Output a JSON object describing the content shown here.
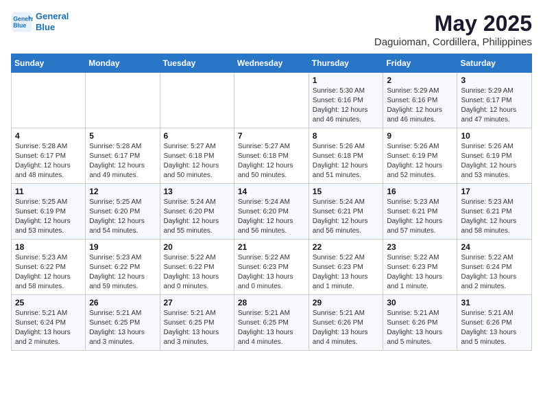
{
  "header": {
    "logo_line1": "General",
    "logo_line2": "Blue",
    "month": "May 2025",
    "location": "Daguioman, Cordillera, Philippines"
  },
  "weekdays": [
    "Sunday",
    "Monday",
    "Tuesday",
    "Wednesday",
    "Thursday",
    "Friday",
    "Saturday"
  ],
  "weeks": [
    [
      {
        "day": "",
        "info": ""
      },
      {
        "day": "",
        "info": ""
      },
      {
        "day": "",
        "info": ""
      },
      {
        "day": "",
        "info": ""
      },
      {
        "day": "1",
        "info": "Sunrise: 5:30 AM\nSunset: 6:16 PM\nDaylight: 12 hours\nand 46 minutes."
      },
      {
        "day": "2",
        "info": "Sunrise: 5:29 AM\nSunset: 6:16 PM\nDaylight: 12 hours\nand 46 minutes."
      },
      {
        "day": "3",
        "info": "Sunrise: 5:29 AM\nSunset: 6:17 PM\nDaylight: 12 hours\nand 47 minutes."
      }
    ],
    [
      {
        "day": "4",
        "info": "Sunrise: 5:28 AM\nSunset: 6:17 PM\nDaylight: 12 hours\nand 48 minutes."
      },
      {
        "day": "5",
        "info": "Sunrise: 5:28 AM\nSunset: 6:17 PM\nDaylight: 12 hours\nand 49 minutes."
      },
      {
        "day": "6",
        "info": "Sunrise: 5:27 AM\nSunset: 6:18 PM\nDaylight: 12 hours\nand 50 minutes."
      },
      {
        "day": "7",
        "info": "Sunrise: 5:27 AM\nSunset: 6:18 PM\nDaylight: 12 hours\nand 50 minutes."
      },
      {
        "day": "8",
        "info": "Sunrise: 5:26 AM\nSunset: 6:18 PM\nDaylight: 12 hours\nand 51 minutes."
      },
      {
        "day": "9",
        "info": "Sunrise: 5:26 AM\nSunset: 6:19 PM\nDaylight: 12 hours\nand 52 minutes."
      },
      {
        "day": "10",
        "info": "Sunrise: 5:26 AM\nSunset: 6:19 PM\nDaylight: 12 hours\nand 53 minutes."
      }
    ],
    [
      {
        "day": "11",
        "info": "Sunrise: 5:25 AM\nSunset: 6:19 PM\nDaylight: 12 hours\nand 53 minutes."
      },
      {
        "day": "12",
        "info": "Sunrise: 5:25 AM\nSunset: 6:20 PM\nDaylight: 12 hours\nand 54 minutes."
      },
      {
        "day": "13",
        "info": "Sunrise: 5:24 AM\nSunset: 6:20 PM\nDaylight: 12 hours\nand 55 minutes."
      },
      {
        "day": "14",
        "info": "Sunrise: 5:24 AM\nSunset: 6:20 PM\nDaylight: 12 hours\nand 56 minutes."
      },
      {
        "day": "15",
        "info": "Sunrise: 5:24 AM\nSunset: 6:21 PM\nDaylight: 12 hours\nand 56 minutes."
      },
      {
        "day": "16",
        "info": "Sunrise: 5:23 AM\nSunset: 6:21 PM\nDaylight: 12 hours\nand 57 minutes."
      },
      {
        "day": "17",
        "info": "Sunrise: 5:23 AM\nSunset: 6:21 PM\nDaylight: 12 hours\nand 58 minutes."
      }
    ],
    [
      {
        "day": "18",
        "info": "Sunrise: 5:23 AM\nSunset: 6:22 PM\nDaylight: 12 hours\nand 58 minutes."
      },
      {
        "day": "19",
        "info": "Sunrise: 5:23 AM\nSunset: 6:22 PM\nDaylight: 12 hours\nand 59 minutes."
      },
      {
        "day": "20",
        "info": "Sunrise: 5:22 AM\nSunset: 6:22 PM\nDaylight: 13 hours\nand 0 minutes."
      },
      {
        "day": "21",
        "info": "Sunrise: 5:22 AM\nSunset: 6:23 PM\nDaylight: 13 hours\nand 0 minutes."
      },
      {
        "day": "22",
        "info": "Sunrise: 5:22 AM\nSunset: 6:23 PM\nDaylight: 13 hours\nand 1 minute."
      },
      {
        "day": "23",
        "info": "Sunrise: 5:22 AM\nSunset: 6:23 PM\nDaylight: 13 hours\nand 1 minute."
      },
      {
        "day": "24",
        "info": "Sunrise: 5:22 AM\nSunset: 6:24 PM\nDaylight: 13 hours\nand 2 minutes."
      }
    ],
    [
      {
        "day": "25",
        "info": "Sunrise: 5:21 AM\nSunset: 6:24 PM\nDaylight: 13 hours\nand 2 minutes."
      },
      {
        "day": "26",
        "info": "Sunrise: 5:21 AM\nSunset: 6:25 PM\nDaylight: 13 hours\nand 3 minutes."
      },
      {
        "day": "27",
        "info": "Sunrise: 5:21 AM\nSunset: 6:25 PM\nDaylight: 13 hours\nand 3 minutes."
      },
      {
        "day": "28",
        "info": "Sunrise: 5:21 AM\nSunset: 6:25 PM\nDaylight: 13 hours\nand 4 minutes."
      },
      {
        "day": "29",
        "info": "Sunrise: 5:21 AM\nSunset: 6:26 PM\nDaylight: 13 hours\nand 4 minutes."
      },
      {
        "day": "30",
        "info": "Sunrise: 5:21 AM\nSunset: 6:26 PM\nDaylight: 13 hours\nand 5 minutes."
      },
      {
        "day": "31",
        "info": "Sunrise: 5:21 AM\nSunset: 6:26 PM\nDaylight: 13 hours\nand 5 minutes."
      }
    ]
  ]
}
